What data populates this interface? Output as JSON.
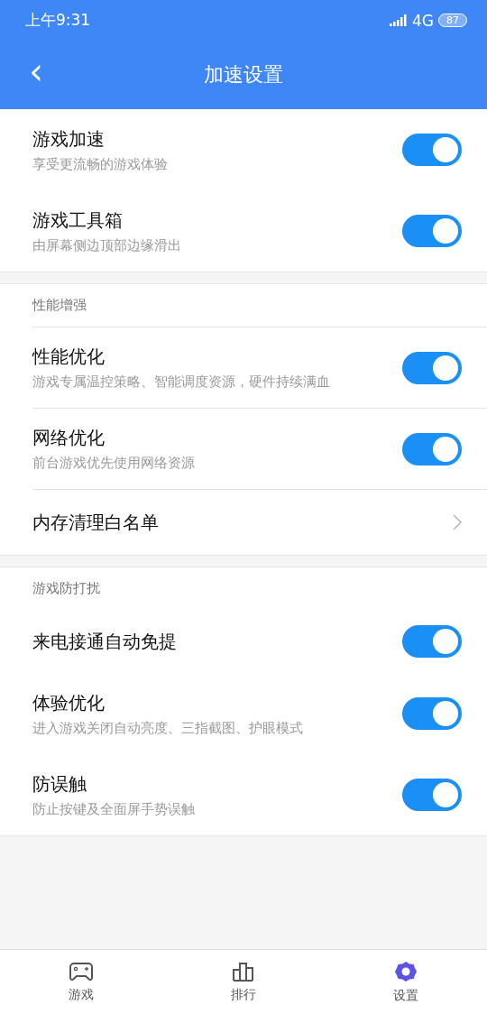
{
  "status_bar": {
    "time": "上午9:31",
    "network": "4G",
    "battery": "87"
  },
  "header": {
    "title": "加速设置",
    "back": "‹"
  },
  "sections": [
    {
      "divided": false,
      "items": [
        {
          "kind": "toggle",
          "title": "游戏加速",
          "subtitle": "享受更流畅的游戏体验",
          "on": true
        },
        {
          "kind": "toggle",
          "title": "游戏工具箱",
          "subtitle": "由屏幕侧边顶部边缘滑出",
          "on": true
        }
      ]
    },
    {
      "title": "性能增强",
      "divided": true,
      "items": [
        {
          "kind": "toggle",
          "title": "性能优化",
          "subtitle": "游戏专属温控策略、智能调度资源，硬件持续满血",
          "on": true
        },
        {
          "kind": "toggle",
          "title": "网络优化",
          "subtitle": "前台游戏优先使用网络资源",
          "on": true
        },
        {
          "kind": "link",
          "title": "内存清理白名单"
        }
      ]
    },
    {
      "title": "游戏防打扰",
      "divided": false,
      "items": [
        {
          "kind": "toggle",
          "title": "来电接通自动免提",
          "on": true
        },
        {
          "kind": "toggle",
          "title": "体验优化",
          "subtitle": "进入游戏关闭自动亮度、三指截图、护眼模式",
          "on": true
        },
        {
          "kind": "toggle",
          "title": "防误触",
          "subtitle": "防止按键及全面屏手势误触",
          "on": true
        }
      ]
    }
  ],
  "tab_bar": [
    {
      "kind": "games",
      "label": "游戏",
      "selected": false
    },
    {
      "kind": "ranking",
      "label": "排行",
      "selected": false
    },
    {
      "kind": "settings",
      "label": "设置",
      "selected": true
    }
  ]
}
